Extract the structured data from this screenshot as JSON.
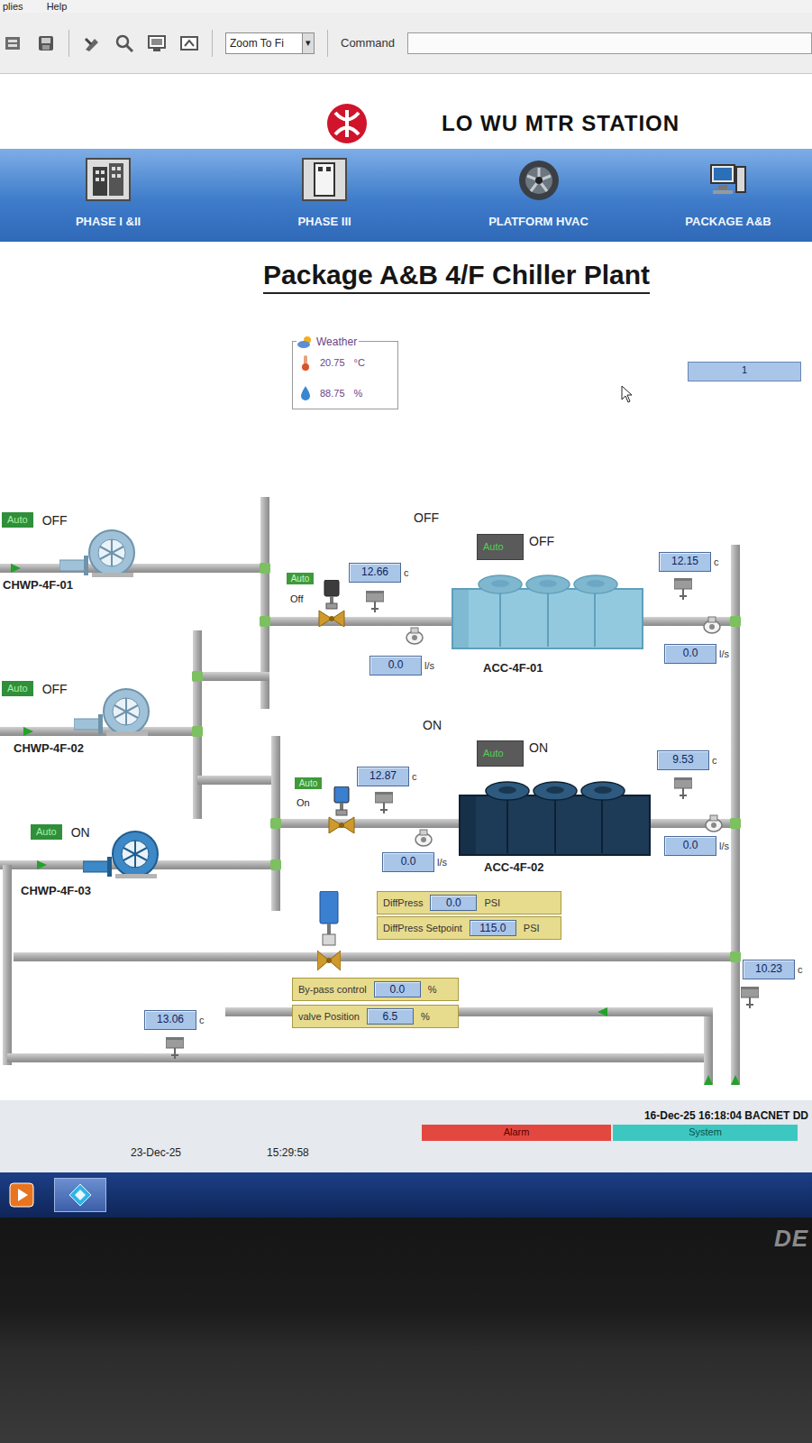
{
  "menu": [
    "plies",
    "Help"
  ],
  "toolbar": {
    "zoom": "Zoom To Fi",
    "zoom_arrow": "▾",
    "command_label": "Command"
  },
  "header": {
    "title": "LO WU MTR STATION"
  },
  "nav": [
    {
      "label": "PHASE I &II",
      "selected": false
    },
    {
      "label": "PHASE III",
      "selected": false
    },
    {
      "label": "PLATFORM HVAC",
      "selected": false
    },
    {
      "label": "PACKAGE A&B",
      "selected": false
    }
  ],
  "page_title": "Package A&B 4/F Chiller Plant",
  "weather": {
    "label": "Weather",
    "temperature": "20.75",
    "temperature_unit": "°C",
    "humidity": "88.75",
    "humidity_unit": "%"
  },
  "page_field": "1",
  "pumps": [
    {
      "name": "CHWP-4F-01",
      "mode": "Auto",
      "status": "OFF",
      "on": false
    },
    {
      "name": "CHWP-4F-02",
      "mode": "Auto",
      "status": "OFF",
      "on": false
    },
    {
      "name": "CHWP-4F-03",
      "mode": "Auto",
      "status": "ON",
      "on": true
    }
  ],
  "chillers": [
    {
      "name": "ACC-4F-01",
      "status_label": "OFF",
      "mode": "Auto",
      "status": "OFF",
      "on": false,
      "valve": {
        "mode": "Auto",
        "status": "Off",
        "open": false
      },
      "entering_temp": {
        "value": "12.66",
        "unit": "c"
      },
      "leaving_temp": {
        "value": "12.15",
        "unit": "c"
      },
      "entering_flow": {
        "value": "0.0",
        "unit": "l/s"
      },
      "leaving_flow": {
        "value": "0.0",
        "unit": "l/s"
      }
    },
    {
      "name": "ACC-4F-02",
      "status_label": "ON",
      "mode": "Auto",
      "status": "ON",
      "on": true,
      "valve": {
        "mode": "Auto",
        "status": "On",
        "open": true
      },
      "entering_temp": {
        "value": "12.87",
        "unit": "c"
      },
      "leaving_temp": {
        "value": "9.53",
        "unit": "c"
      },
      "entering_flow": {
        "value": "0.0",
        "unit": "l/s"
      },
      "leaving_flow": {
        "value": "0.0",
        "unit": "l/s"
      }
    }
  ],
  "diff_pressure": {
    "label": "DiffPress",
    "value": "0.0",
    "unit": "PSI"
  },
  "diff_pressure_setpoint": {
    "label": "DiffPress Setpoint",
    "value": "115.0",
    "unit": "PSI"
  },
  "bypass": [
    {
      "label": "By-pass control",
      "value": "0.0",
      "unit": "%"
    },
    {
      "label": "valve Position",
      "value": "6.5",
      "unit": "%"
    }
  ],
  "common_return_temp": {
    "value": "13.06",
    "unit": "c"
  },
  "common_supply_temp": {
    "value": "10.23",
    "unit": "c"
  },
  "status_bar": {
    "datetime": "16-Dec-25 16:18:04 BACNET DD",
    "indicators": [
      {
        "label": "Alarm",
        "color": "#e2483f"
      },
      {
        "label": "System",
        "color": "#3cc8c0"
      }
    ]
  },
  "footer": {
    "date": "23-Dec-25",
    "time": "15:29:58"
  },
  "monitor": {
    "brand": "DE"
  }
}
